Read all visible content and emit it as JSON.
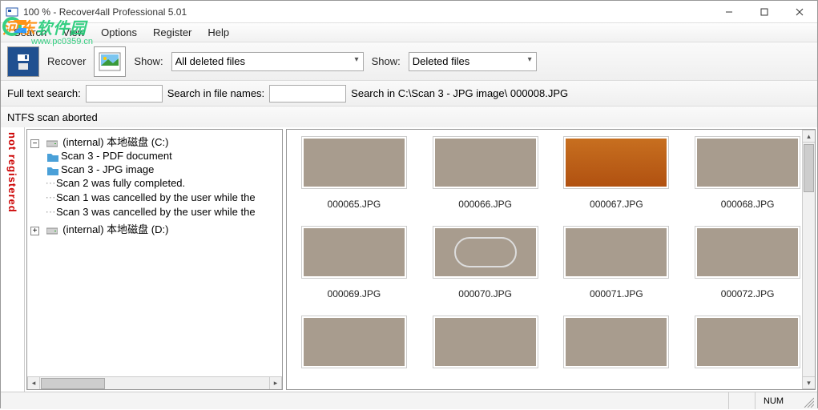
{
  "window": {
    "title": "100 % - Recover4all Professional 5.01"
  },
  "menu": [
    "Search",
    "View",
    "Options",
    "Register",
    "Help"
  ],
  "toolbar": {
    "recover_label": "Recover",
    "show1_label": "Show:",
    "show1_selected": "All deleted files",
    "show2_label": "Show:",
    "show2_selected": "Deleted files"
  },
  "search": {
    "full_text_label": "Full text search:",
    "full_text_value": "",
    "filename_label": "Search in file names:",
    "filename_value": "",
    "path_label": "Search in C:\\Scan 3 - JPG image\\ 000008.JPG"
  },
  "status_message": "NTFS scan aborted",
  "side_badge": "not registered",
  "tree": {
    "c_drive": "(internal) 本地磁盘 (C:)",
    "c_children": [
      {
        "icon": "folder",
        "label": "Scan 3 - PDF document"
      },
      {
        "icon": "folder",
        "label": "Scan 3 - JPG image"
      },
      {
        "icon": "none",
        "label": "Scan 2 was fully completed."
      },
      {
        "icon": "none",
        "label": "Scan 1 was cancelled by the user while the"
      },
      {
        "icon": "none",
        "label": "Scan 3 was cancelled by the user while the"
      }
    ],
    "d_drive": "(internal) 本地磁盘 (D:)"
  },
  "thumbnails": [
    {
      "name": "000065.JPG",
      "variant": ""
    },
    {
      "name": "000066.JPG",
      "variant": ""
    },
    {
      "name": "000067.JPG",
      "variant": "orange"
    },
    {
      "name": "000068.JPG",
      "variant": ""
    },
    {
      "name": "000069.JPG",
      "variant": ""
    },
    {
      "name": "000070.JPG",
      "variant": "round"
    },
    {
      "name": "000071.JPG",
      "variant": ""
    },
    {
      "name": "000072.JPG",
      "variant": ""
    },
    {
      "name": "",
      "variant": ""
    },
    {
      "name": "",
      "variant": ""
    },
    {
      "name": "",
      "variant": ""
    },
    {
      "name": "",
      "variant": ""
    }
  ],
  "statusbar": {
    "num": "NUM"
  },
  "watermark": {
    "line1a": "河东",
    "line1b": "软件园",
    "line2": "www.pc0359.cn"
  }
}
